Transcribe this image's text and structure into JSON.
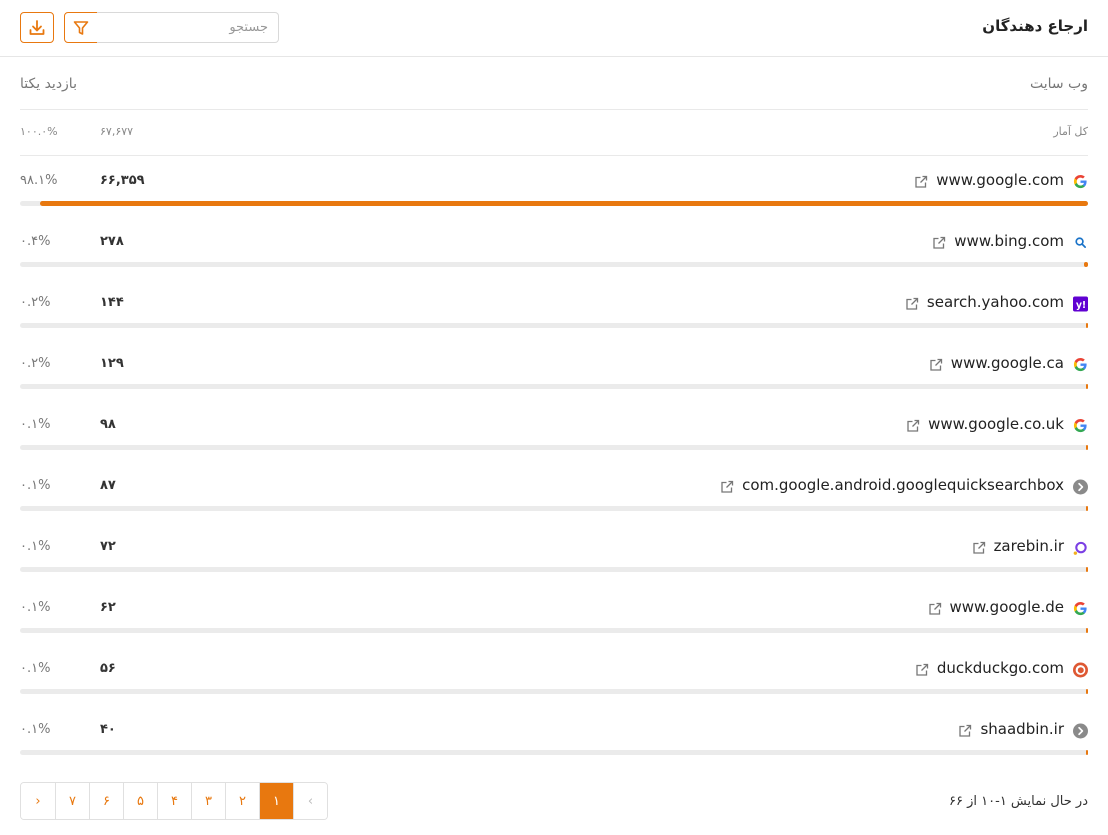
{
  "header": {
    "title": "ارجاع دهندگان",
    "search_placeholder": "جستجو"
  },
  "columns": {
    "site": "وب سایت",
    "visits": "بازدید یکتا"
  },
  "total": {
    "label": "کل آمار",
    "value": "۶۷,۶۷۷",
    "pct": "۱۰۰.۰%"
  },
  "accent_color": "#e8780f",
  "rows": [
    {
      "site": "www.google.com",
      "count": "۶۶,۳۵۹",
      "pct": "۹۸.۱%",
      "share": 98.1,
      "icon": "google-icon"
    },
    {
      "site": "www.bing.com",
      "count": "۲۷۸",
      "pct": "۰.۴%",
      "share": 0.4,
      "icon": "bing-icon"
    },
    {
      "site": "search.yahoo.com",
      "count": "۱۴۴",
      "pct": "۰.۲%",
      "share": 0.2,
      "icon": "yahoo-icon"
    },
    {
      "site": "www.google.ca",
      "count": "۱۲۹",
      "pct": "۰.۲%",
      "share": 0.2,
      "icon": "google-icon"
    },
    {
      "site": "www.google.co.uk",
      "count": "۹۸",
      "pct": "۰.۱%",
      "share": 0.1,
      "icon": "google-icon"
    },
    {
      "site": "com.google.android.googlequicksearchbox",
      "count": "۸۷",
      "pct": "۰.۱%",
      "share": 0.1,
      "icon": "generic-site-icon"
    },
    {
      "site": "zarebin.ir",
      "count": "۷۲",
      "pct": "۰.۱%",
      "share": 0.1,
      "icon": "zarebin-icon"
    },
    {
      "site": "www.google.de",
      "count": "۶۲",
      "pct": "۰.۱%",
      "share": 0.1,
      "icon": "google-icon"
    },
    {
      "site": "duckduckgo.com",
      "count": "۵۶",
      "pct": "۰.۱%",
      "share": 0.1,
      "icon": "duckduckgo-icon"
    },
    {
      "site": "shaadbin.ir",
      "count": "۴۰",
      "pct": "۰.۱%",
      "share": 0.1,
      "icon": "generic-site-icon"
    }
  ],
  "pagination": {
    "prev": "‹",
    "next": "›",
    "pages": [
      "۱",
      "۲",
      "۳",
      "۴",
      "۵",
      "۶",
      "۷"
    ],
    "current": "۱",
    "status": "در حال نمایش ۱-۱۰ از ۶۶"
  }
}
